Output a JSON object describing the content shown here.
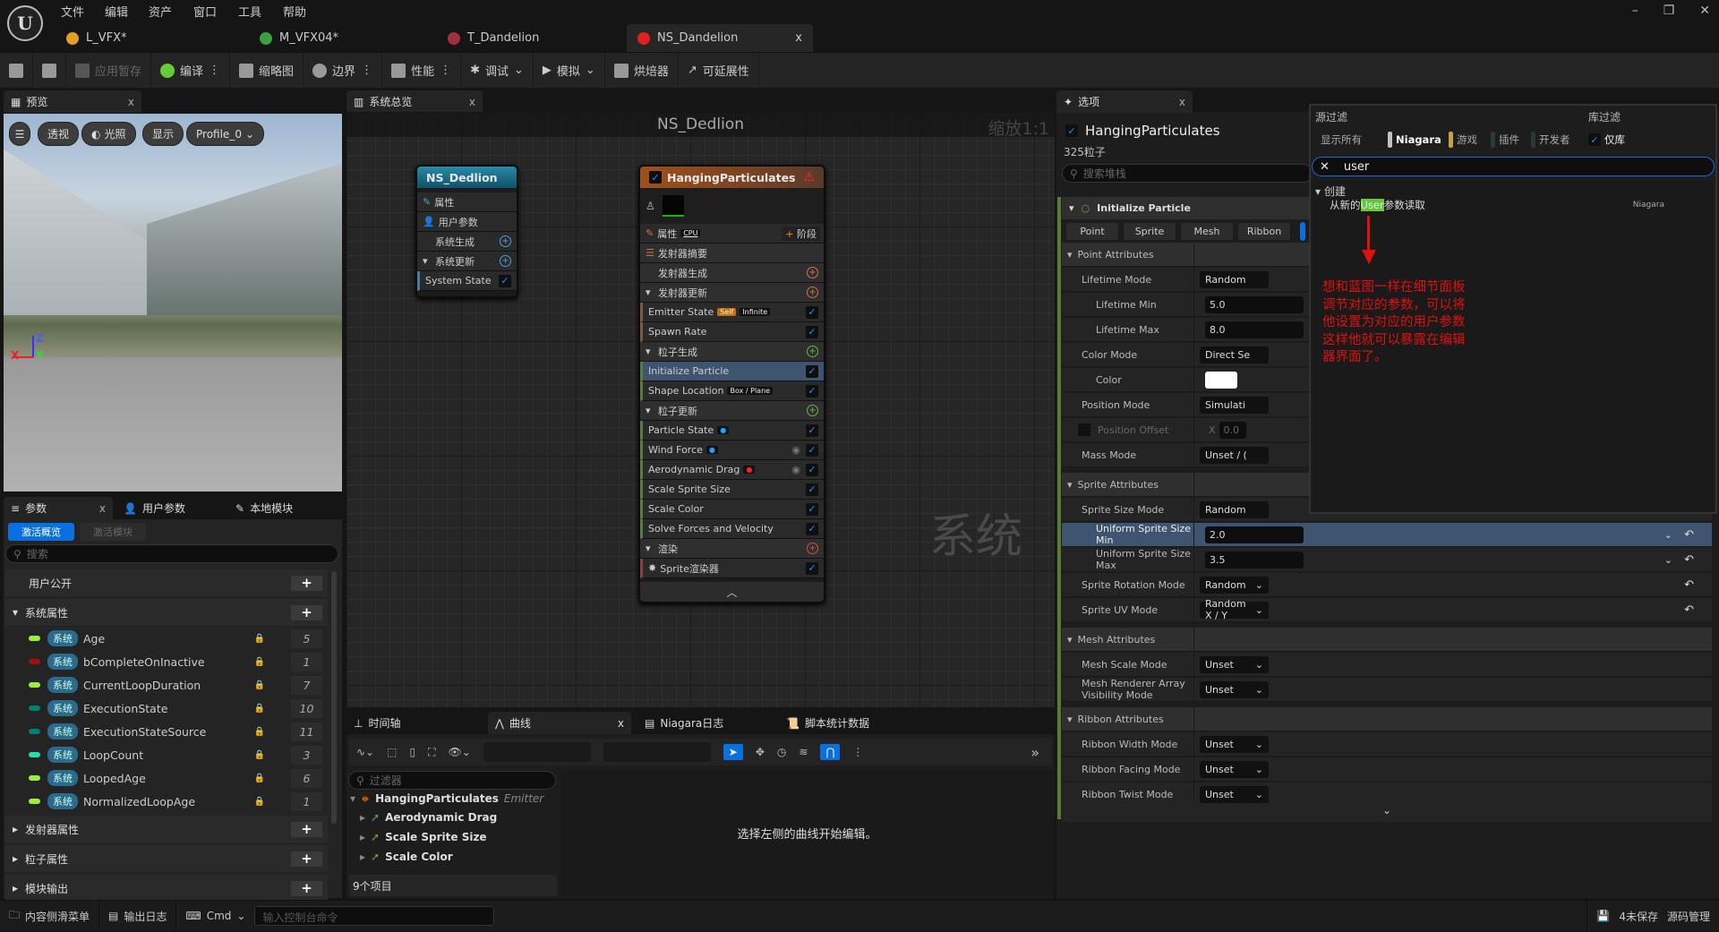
{
  "menu": [
    "文件",
    "编辑",
    "资产",
    "窗口",
    "工具",
    "帮助"
  ],
  "window_controls": {
    "minimize": "–",
    "restore": "❐",
    "close": "✕"
  },
  "doc_tabs": [
    {
      "label": "L_VFX*",
      "icon": "level-icon",
      "color": "#e0a020"
    },
    {
      "label": "M_VFX04*",
      "icon": "material-icon",
      "color": "#3aa040"
    },
    {
      "label": "T_Dandelion",
      "icon": "texture-icon",
      "color": "#a03040"
    },
    {
      "label": "NS_Dandelion",
      "icon": "niagara-system-icon",
      "color": "#e02020",
      "close": "x"
    }
  ],
  "toolbar": {
    "apply": "应用暂存",
    "compile": "编译",
    "thumbnail": "缩略图",
    "bounds": "边界",
    "performance": "性能",
    "debug": "调试",
    "simulate": "模拟",
    "baker": "烘焙器",
    "scalability": "可延展性"
  },
  "preview": {
    "tab": "预览",
    "close": "x",
    "perspective": "透视",
    "lighting": "光照",
    "show": "显示",
    "profile": "Profile_0",
    "axes": {
      "z": "Z",
      "x": "X",
      "y": "Y"
    }
  },
  "params": {
    "tabs": [
      "参数",
      "用户参数",
      "本地模块"
    ],
    "close": "x",
    "mode_active": "激活概览",
    "mode_module": "激活模块",
    "search_placeholder": "搜索",
    "sections": {
      "user": "用户公开",
      "system": "系统属性",
      "emitter": "发射器属性",
      "particle": "粒子属性",
      "module_out": "模块输出"
    },
    "items": [
      {
        "tag": "系统",
        "name": "Age",
        "color": "#9cf03c",
        "count": "5"
      },
      {
        "tag": "系统",
        "name": "bCompleteOnInactive",
        "color": "#a01010",
        "count": "1"
      },
      {
        "tag": "系统",
        "name": "CurrentLoopDuration",
        "color": "#9cf03c",
        "count": "7"
      },
      {
        "tag": "系统",
        "name": "ExecutionState",
        "color": "#008070",
        "count": "10"
      },
      {
        "tag": "系统",
        "name": "ExecutionStateSource",
        "color": "#008070",
        "count": "11"
      },
      {
        "tag": "系统",
        "name": "LoopCount",
        "color": "#20e0b0",
        "count": "3"
      },
      {
        "tag": "系统",
        "name": "LoopedAge",
        "color": "#9cf03c",
        "count": "6"
      },
      {
        "tag": "系统",
        "name": "NormalizedLoopAge",
        "color": "#9cf03c",
        "count": "1"
      }
    ]
  },
  "graph": {
    "tab": "系统总览",
    "close": "x",
    "title": "NS_Dedlion",
    "zoom": "缩放1:1",
    "watermark": "系统",
    "system_node": {
      "title": "NS_Dedlion",
      "rows": [
        {
          "label": "属性",
          "type": "cat-icon"
        },
        {
          "label": "用户参数",
          "type": "cat-icon"
        },
        {
          "label": "系统生成",
          "type": "stage"
        },
        {
          "label": "系统更新",
          "type": "stage-open"
        },
        {
          "label": "System State",
          "type": "module"
        }
      ]
    },
    "emitter_node": {
      "title": "HangingParticulates",
      "props": "属性",
      "cpu": "CPU",
      "stage_btn": "阶段",
      "rows": [
        {
          "label": "发射器摘要",
          "type": "summary"
        },
        {
          "label": "发射器生成",
          "type": "stage",
          "color": "#d0704a"
        },
        {
          "label": "发射器更新",
          "type": "stage-open",
          "color": "#d0704a"
        },
        {
          "label": "Emitter State",
          "type": "module",
          "chips": [
            "Self",
            "Infinite"
          ],
          "bar": "#7a5a40"
        },
        {
          "label": "Spawn Rate",
          "type": "module",
          "bar": "#7a5a40"
        },
        {
          "label": "粒子生成",
          "type": "stage-open",
          "color": "#6ab04a"
        },
        {
          "label": "Initialize Particle",
          "type": "module",
          "selected": true,
          "bar": "#5a7a40"
        },
        {
          "label": "Shape Location",
          "type": "module",
          "chips": [
            "Box / Plane"
          ],
          "bar": "#5a7a40"
        },
        {
          "label": "粒子更新",
          "type": "stage-open",
          "color": "#6ab04a"
        },
        {
          "label": "Particle State",
          "type": "module",
          "dot": "#20a0ff",
          "bar": "#5a7a40"
        },
        {
          "label": "Wind Force",
          "type": "module",
          "dot": "#20a0ff",
          "eye": true,
          "bar": "#5a7a40"
        },
        {
          "label": "Aerodynamic Drag",
          "type": "module",
          "dot": "#ff2020",
          "eye": true,
          "bar": "#5a7a40"
        },
        {
          "label": "Scale Sprite Size",
          "type": "module",
          "bar": "#5a7a40"
        },
        {
          "label": "Scale Color",
          "type": "module",
          "bar": "#5a7a40"
        },
        {
          "label": "Solve Forces and Velocity",
          "type": "module",
          "bar": "#5a7a40"
        },
        {
          "label": "渲染",
          "type": "stage-open",
          "color": "#d0504a"
        },
        {
          "label": "Sprite渲染器",
          "type": "module",
          "bar": "#8a4040"
        }
      ]
    }
  },
  "bottom": {
    "tabs": [
      "时间轴",
      "曲线",
      "Niagara日志",
      "脚本统计数据"
    ],
    "close": "x",
    "filter_placeholder": "过滤器",
    "emitter": "HangingParticulates",
    "emitter_kind": "Emitter",
    "curves": [
      "Aerodynamic Drag",
      "Scale Sprite Size",
      "Scale Color"
    ],
    "count": "9个项目",
    "empty_message": "选择左侧的曲线开始编辑。"
  },
  "details": {
    "tab": "选项",
    "close": "x",
    "emitter": "HangingParticulates",
    "particles": "325粒子",
    "search_placeholder": "搜索堆栈",
    "module": "Initialize Particle",
    "filter_tabs": [
      "Point",
      "Sprite",
      "Mesh",
      "Ribbon"
    ],
    "rows": [
      {
        "label": "Point Attributes",
        "kind": "header"
      },
      {
        "label": "Lifetime Mode",
        "kind": "dropdown",
        "value": "Random"
      },
      {
        "label": "Lifetime Min",
        "kind": "number",
        "value": "5.0"
      },
      {
        "label": "Lifetime Max",
        "kind": "number",
        "value": "8.0"
      },
      {
        "label": "Color Mode",
        "kind": "dropdown",
        "value": "Direct Se"
      },
      {
        "label": "Color",
        "kind": "color",
        "value": "#ffffff"
      },
      {
        "label": "Position Mode",
        "kind": "dropdown",
        "value": "Simulati"
      },
      {
        "label": "Position Offset",
        "kind": "vector",
        "value": "0.0",
        "axis": "X"
      },
      {
        "label": "Mass Mode",
        "kind": "dropdown",
        "value": "Unset / ("
      },
      {
        "label": "Sprite Attributes",
        "kind": "header"
      },
      {
        "label": "Sprite Size Mode",
        "kind": "dropdown",
        "value": "Random"
      },
      {
        "label": "Uniform Sprite Size Min",
        "kind": "number",
        "value": "2.0",
        "selected": true,
        "reset": true
      },
      {
        "label": "Uniform Sprite Size Max",
        "kind": "number",
        "value": "3.5",
        "reset": true
      },
      {
        "label": "Sprite Rotation Mode",
        "kind": "dropdown",
        "value": "Random",
        "reset": true
      },
      {
        "label": "Sprite UV Mode",
        "kind": "dropdown",
        "value": "Random X / Y",
        "reset": true
      },
      {
        "label": "Mesh Attributes",
        "kind": "header"
      },
      {
        "label": "Mesh Scale Mode",
        "kind": "dropdown",
        "value": "Unset"
      },
      {
        "label": "Mesh Renderer Array Visibility Mode",
        "kind": "dropdown",
        "value": "Unset"
      },
      {
        "label": "Ribbon Attributes",
        "kind": "header"
      },
      {
        "label": "Ribbon Width Mode",
        "kind": "dropdown",
        "value": "Unset"
      },
      {
        "label": "Ribbon Facing Mode",
        "kind": "dropdown",
        "value": "Unset"
      },
      {
        "label": "Ribbon Twist Mode",
        "kind": "dropdown",
        "value": "Unset"
      }
    ]
  },
  "popup": {
    "source_filter": "源过滤",
    "library_filter": "库过滤",
    "chips": [
      {
        "label": "显示所有",
        "color": ""
      },
      {
        "label": "Niagara",
        "color": "#c8c0c0"
      },
      {
        "label": "游戏",
        "color": "#c8a040"
      },
      {
        "label": "插件",
        "color": "#2a3a38"
      },
      {
        "label": "开发者",
        "color": "#2a3a30"
      }
    ],
    "library_only": "仅库",
    "search_value": "user",
    "category": "创建",
    "result_prefix": "从新的",
    "result_highlight": "User",
    "result_suffix": "参数读取",
    "result_source": "Niagara",
    "annotation": "想和蓝图一样在细节面板调节对应的参数，可以将他设置为对应的用户参数这样他就可以暴露在编辑器界面了。",
    "annotation_color": "#e01010"
  },
  "status": {
    "content_drawer": "内容侧滑菜单",
    "output_log": "输出日志",
    "cmd": "Cmd",
    "console_placeholder": "输入控制台命令",
    "unsaved": "4未保存",
    "source_control": "源码管理"
  }
}
